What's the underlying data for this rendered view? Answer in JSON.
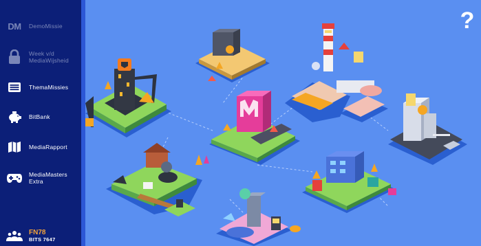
{
  "sidebar": {
    "logo_text": "DM",
    "items": [
      {
        "label": "DemoMissie",
        "icon": "dm-logo",
        "enabled": true
      },
      {
        "label": "Week v/d\nMediaWijsheid",
        "icon": "lock-icon",
        "enabled": false
      },
      {
        "label": "ThemaMissies",
        "icon": "newspaper-icon",
        "enabled": true
      },
      {
        "label": "BitBank",
        "icon": "piggy-bank-icon",
        "enabled": true
      },
      {
        "label": "MediaRapport",
        "icon": "map-icon",
        "enabled": true
      },
      {
        "label": "MediaMasters\nExtra",
        "icon": "gamepad-icon",
        "enabled": true
      }
    ],
    "user": {
      "code": "FN78",
      "bits": "BITS 7647",
      "icon": "group-icon"
    }
  },
  "map": {
    "help": "?",
    "background_color": "#5a8ff1",
    "islands": [
      {
        "name": "construction-island"
      },
      {
        "name": "safe-island"
      },
      {
        "name": "lighthouse-island"
      },
      {
        "name": "media-tower-island"
      },
      {
        "name": "skyscraper-island"
      },
      {
        "name": "village-island"
      },
      {
        "name": "arcade-city-island"
      },
      {
        "name": "game-island"
      }
    ]
  }
}
